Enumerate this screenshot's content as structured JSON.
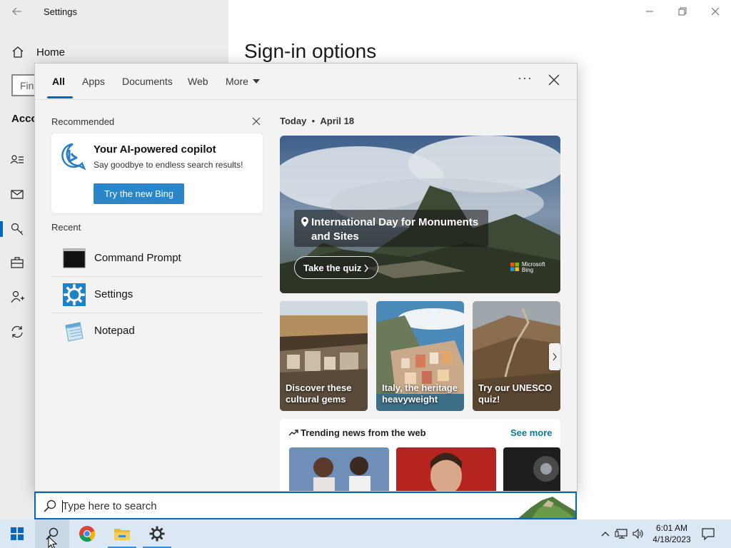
{
  "settings": {
    "title": "Settings",
    "home": "Home",
    "find_placeholder": "Fin",
    "section": "Acco",
    "page_heading": "Sign-in options"
  },
  "search_panel": {
    "tabs": [
      {
        "label": "All"
      },
      {
        "label": "Apps"
      },
      {
        "label": "Documents"
      },
      {
        "label": "Web"
      },
      {
        "label": "More"
      }
    ],
    "recommended": {
      "label": "Recommended",
      "card_title": "Your AI-powered copilot",
      "card_subtitle": "Say goodbye to endless search results!",
      "button": "Try the new Bing"
    },
    "recent": {
      "label": "Recent",
      "items": [
        {
          "name": "Command Prompt"
        },
        {
          "name": "Settings"
        },
        {
          "name": "Notepad"
        }
      ]
    },
    "today": {
      "label": "Today",
      "date": "April 18"
    },
    "hero": {
      "title": "International Day for Monuments and Sites",
      "button": "Take the quiz",
      "brand_line1": "Microsoft",
      "brand_line2": "Bing"
    },
    "tiles": [
      {
        "text": "Discover these cultural gems"
      },
      {
        "text": "Italy, the heritage heavyweight"
      },
      {
        "text": "Try our UNESCO quiz!"
      }
    ],
    "trending": {
      "label": "Trending news from the web",
      "see_more": "See more"
    }
  },
  "search_bar": {
    "placeholder": "Type here to search"
  },
  "taskbar": {
    "time": "6:01 AM",
    "date": "4/18/2023"
  },
  "colors": {
    "accent": "#0067c0",
    "bing_button": "#2a86c8",
    "taskbar": "#dbe8f3"
  }
}
